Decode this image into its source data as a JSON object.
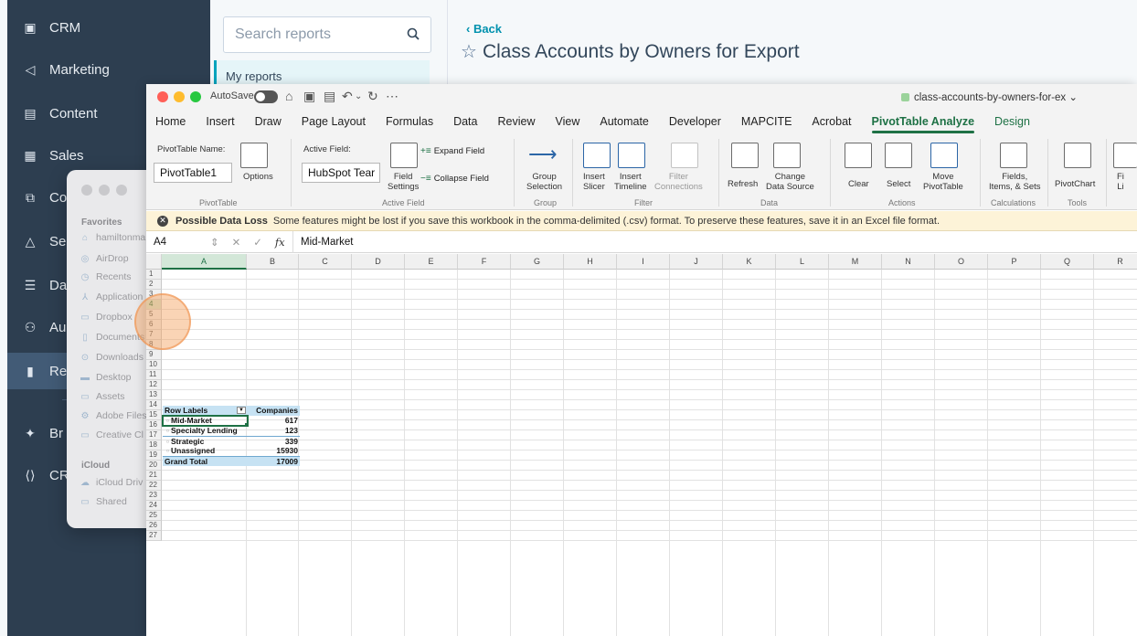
{
  "hs_nav": {
    "items": [
      {
        "label": "CRM",
        "icon": "crm-icon",
        "glyph": "▣"
      },
      {
        "label": "Marketing",
        "icon": "megaphone-icon",
        "glyph": "◁"
      },
      {
        "label": "Content",
        "icon": "content-icon",
        "glyph": "▤"
      },
      {
        "label": "Sales",
        "icon": "sales-icon",
        "glyph": "▦"
      },
      {
        "label": "Co",
        "icon": "commerce-icon",
        "glyph": "⧉"
      },
      {
        "label": "Se",
        "icon": "service-icon",
        "glyph": "△"
      },
      {
        "label": "Da",
        "icon": "data-icon",
        "glyph": "☰"
      },
      {
        "label": "Au",
        "icon": "automation-icon",
        "glyph": "⚇"
      },
      {
        "label": "Re",
        "icon": "reporting-icon",
        "glyph": "▮",
        "active": true
      },
      {
        "label": "Br",
        "icon": "breeze-icon",
        "glyph": "✦"
      },
      {
        "label": "CR",
        "icon": "cms-icon",
        "glyph": "⟨⟩"
      }
    ]
  },
  "reports_panel": {
    "search_placeholder": "Search reports",
    "my_reports": "My reports"
  },
  "report_header": {
    "back": "‹ Back",
    "title": "Class Accounts by Owners for Export",
    "star": "☆"
  },
  "finder": {
    "favorites_label": "Favorites",
    "favorites": [
      "hamiltonma",
      "AirDrop",
      "Recents",
      "Application",
      "Dropbox",
      "Documents",
      "Downloads",
      "Desktop",
      "Assets",
      "Adobe Files",
      "Creative Cl"
    ],
    "icloud_label": "iCloud",
    "icloud": [
      "iCloud Driv",
      "Shared"
    ]
  },
  "excel": {
    "autosave": "AutoSave",
    "doc_name": "class-accounts-by-owners-for-ex ⌄",
    "tabs": [
      "Home",
      "Insert",
      "Draw",
      "Page Layout",
      "Formulas",
      "Data",
      "Review",
      "View",
      "Automate",
      "Developer",
      "MAPCITE",
      "Acrobat",
      "PivotTable Analyze",
      "Design"
    ],
    "active_tab": "PivotTable Analyze",
    "ribbon": {
      "pivot_name_label": "PivotTable Name:",
      "pivot_name": "PivotTable1",
      "options": "Options",
      "group_pivottable": "PivotTable",
      "active_field_label": "Active Field:",
      "active_field": "HubSpot Tear",
      "field_settings": "Field\nSettings",
      "expand_field": "Expand Field",
      "collapse_field": "Collapse Field",
      "group_active_field": "Active Field",
      "group_selection": "Group\nSelection",
      "group_group": "Group",
      "insert_slicer": "Insert\nSlicer",
      "insert_timeline": "Insert\nTimeline",
      "filter_connections": "Filter\nConnections",
      "group_filter": "Filter",
      "refresh": "Refresh",
      "change_data_source": "Change\nData Source",
      "group_data": "Data",
      "clear": "Clear",
      "select": "Select",
      "move_pivottable": "Move\nPivotTable",
      "group_actions": "Actions",
      "fields_items_sets": "Fields,\nItems, & Sets",
      "group_calculations": "Calculations",
      "pivotchart": "PivotChart",
      "group_tools": "Tools",
      "fi_cut": "Fi\nLi"
    },
    "message": {
      "title": "Possible Data Loss",
      "text": "Some features might be lost if you save this workbook in the comma-delimited (.csv) format. To preserve these features, save it in an Excel file format."
    },
    "formula_bar": {
      "name_box": "A4",
      "value": "Mid-Market"
    },
    "columns": [
      "A",
      "B",
      "C",
      "D",
      "E",
      "F",
      "G",
      "H",
      "I",
      "J",
      "K",
      "L",
      "M",
      "N",
      "O",
      "P",
      "Q",
      "R"
    ],
    "rows": [
      "1",
      "2",
      "3",
      "4",
      "5",
      "6",
      "7",
      "8",
      "9",
      "10",
      "11",
      "12",
      "13",
      "14",
      "15",
      "16",
      "17",
      "18",
      "19",
      "20",
      "21",
      "22",
      "23",
      "24",
      "25",
      "26",
      "27"
    ],
    "pivot": {
      "header_label": "Row Labels",
      "header_value": "Companies",
      "rows": [
        {
          "label": "Mid-Market",
          "value": "617"
        },
        {
          "label": "Specialty Lending",
          "value": "123"
        },
        {
          "label": "Strategic",
          "value": "339"
        },
        {
          "label": "Unassigned",
          "value": "15930"
        }
      ],
      "total_label": "Grand Total",
      "total_value": "17009"
    }
  }
}
